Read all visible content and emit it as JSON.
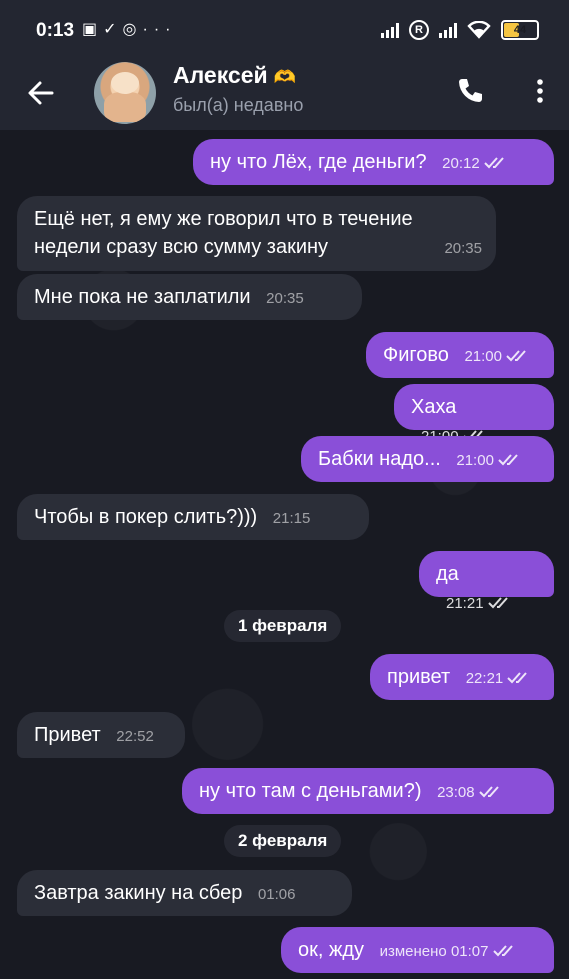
{
  "status_bar": {
    "time": "0:13",
    "battery": "44"
  },
  "header": {
    "name": "Алексей",
    "status": "был(а) недавно"
  },
  "messages": [
    {
      "dir": "out",
      "text": "ну что Лёх, где деньги?",
      "time": "20:12",
      "read": true
    },
    {
      "dir": "in",
      "text": "Ещё нет, я ему же говорил что в течение недели сразу всю сумму закину",
      "time": "20:35"
    },
    {
      "dir": "in",
      "text": "Мне пока не заплатили",
      "time": "20:35"
    },
    {
      "dir": "out",
      "text": "Фигово",
      "time": "21:00",
      "read": true
    },
    {
      "dir": "out",
      "text": "Хаха",
      "time": "21:00",
      "read": true
    },
    {
      "dir": "out",
      "text": "Бабки надо...",
      "time": "21:00",
      "read": true
    },
    {
      "dir": "in",
      "text": "Чтобы в покер слить?)))",
      "time": "21:15"
    },
    {
      "dir": "out",
      "text": "да",
      "time": "21:21",
      "read": true
    },
    {
      "dir": "date",
      "text": "1 февраля"
    },
    {
      "dir": "out",
      "text": "привет",
      "time": "22:21",
      "read": true
    },
    {
      "dir": "in",
      "text": "Привет",
      "time": "22:52"
    },
    {
      "dir": "out",
      "text": "ну что там с деньгами?)",
      "time": "23:08",
      "read": true
    },
    {
      "dir": "date",
      "text": "2 февраля"
    },
    {
      "dir": "in",
      "text": "Завтра закину на сбер",
      "time": "01:06"
    },
    {
      "dir": "out",
      "text": "ок, жду",
      "time": "01:07",
      "edited": "изменено",
      "read": true
    }
  ]
}
